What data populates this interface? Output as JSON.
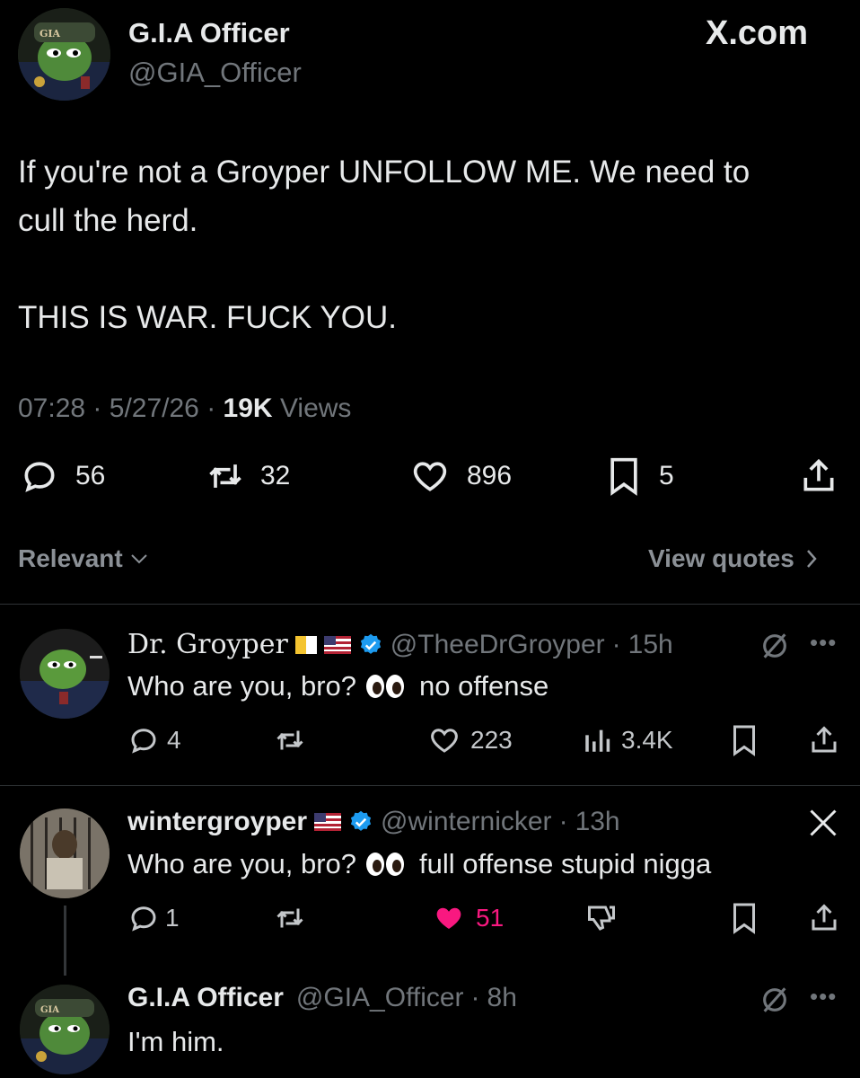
{
  "main_post": {
    "display_name": "G.I.A Officer",
    "handle": "@GIA_Officer",
    "site_label": "X.com",
    "text_line1": "If you're not a Groyper UNFOLLOW ME. We need to",
    "text_line2": "cull the herd.",
    "text_line3": "THIS IS WAR. FUCK YOU.",
    "time": "07:28",
    "date": "5/27/26",
    "views_count": "19K",
    "views_label": "Views",
    "replies": "56",
    "reposts": "32",
    "likes": "896",
    "bookmarks": "5"
  },
  "sort": {
    "label": "Relevant",
    "view_quotes": "View quotes"
  },
  "replies": [
    {
      "display_name": "Dr. Groyper",
      "handle": "@TheeDrGroyper",
      "time": "15h",
      "text": "Who are you, bro?",
      "text_after": "no offense",
      "replies": "4",
      "reposts": "",
      "likes": "223",
      "views": "3.4K"
    },
    {
      "display_name": "wintergroyper",
      "handle": "@winternicker",
      "time": "13h",
      "text": "Who are you, bro?",
      "text_after": "full offense stupid nigga",
      "replies": "1",
      "reposts": "",
      "likes": "51"
    },
    {
      "display_name": "G.I.A Officer",
      "handle": "@GIA_Officer",
      "time": "8h",
      "text": "I'm him."
    }
  ],
  "avatar_badge": "GIA",
  "colors": {
    "background": "#000000",
    "text": "#e7e9ea",
    "muted": "#71767b",
    "verified": "#1d9bf0",
    "like_active": "#f91880",
    "divider": "#2f3336"
  },
  "separator": "·"
}
